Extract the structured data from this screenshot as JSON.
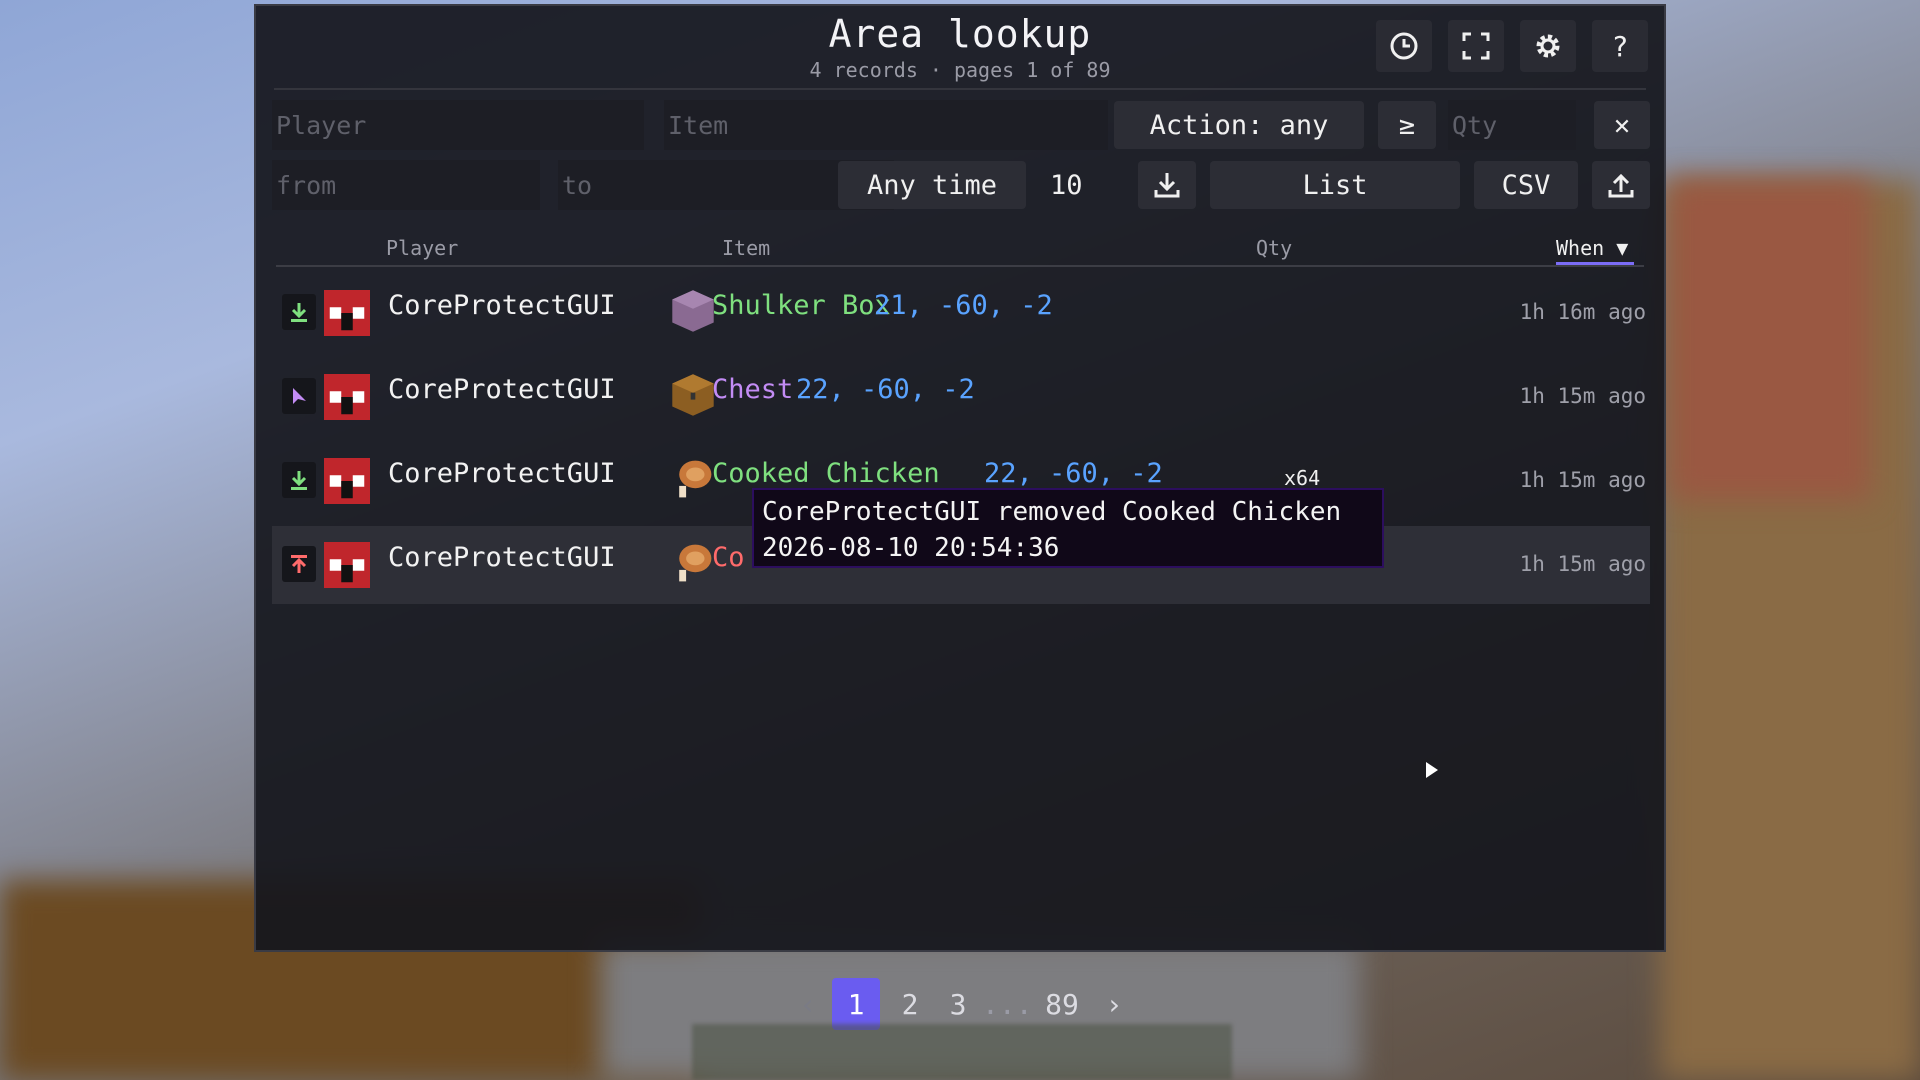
{
  "header": {
    "title": "Area lookup",
    "subtitle": "4 records · pages 1 of 89",
    "icons": [
      "clock-icon",
      "fullscreen-icon",
      "gear-icon",
      "help-icon"
    ],
    "help_label": "?"
  },
  "filters": {
    "player_placeholder": "Player",
    "item_placeholder": "Item",
    "action_label": "Action: any",
    "compare_label": "≥",
    "qty_placeholder": "Qty",
    "clear_label": "✕",
    "from_placeholder": "from",
    "to_placeholder": "to",
    "time_label": "Any time",
    "page_size": "10",
    "view_label": "List",
    "csv_label": "CSV"
  },
  "table": {
    "columns": {
      "player": "Player",
      "item": "Item",
      "qty": "Qty",
      "when": "When ▼"
    },
    "rows": [
      {
        "action_icon": "deposit-icon",
        "player": "CoreProtectGUI",
        "item_icon": "shulker-box-icon",
        "item": "Shulker Box",
        "item_color": "#7fe07f",
        "coords": "21, -60, -2",
        "qty": "",
        "when": "1h 16m ago"
      },
      {
        "action_icon": "interact-icon",
        "player": "CoreProtectGUI",
        "item_icon": "chest-icon",
        "item": "Chest",
        "item_color": "#c38cf5",
        "coords": "22, -60, -2",
        "qty": "",
        "when": "1h 15m ago"
      },
      {
        "action_icon": "deposit-icon",
        "player": "CoreProtectGUI",
        "item_icon": "cooked-chicken-icon",
        "item": "Cooked Chicken",
        "item_color": "#7fe07f",
        "coords": "22, -60, -2",
        "qty": "x64",
        "when": "1h 15m ago"
      },
      {
        "action_icon": "withdraw-icon",
        "player": "CoreProtectGUI",
        "item_icon": "cooked-chicken-icon",
        "item": "Co",
        "item_color": "#ff6b6b",
        "coords": "",
        "qty": "",
        "when": "1h 15m ago"
      }
    ]
  },
  "tooltip": {
    "line1": "CoreProtectGUI removed Cooked Chicken",
    "line2": "2026-08-10 20:54:36"
  },
  "pagination": {
    "prev": "‹",
    "pages": [
      "1",
      "2",
      "3"
    ],
    "ellipsis": "...",
    "last": "89",
    "next": "›",
    "current": "1"
  },
  "colors": {
    "accent": "#6a5cf0",
    "coords": "#5aa3ff",
    "deposit": "#7fe07f",
    "withdraw": "#ff6b6b",
    "interact": "#c38cf5"
  }
}
